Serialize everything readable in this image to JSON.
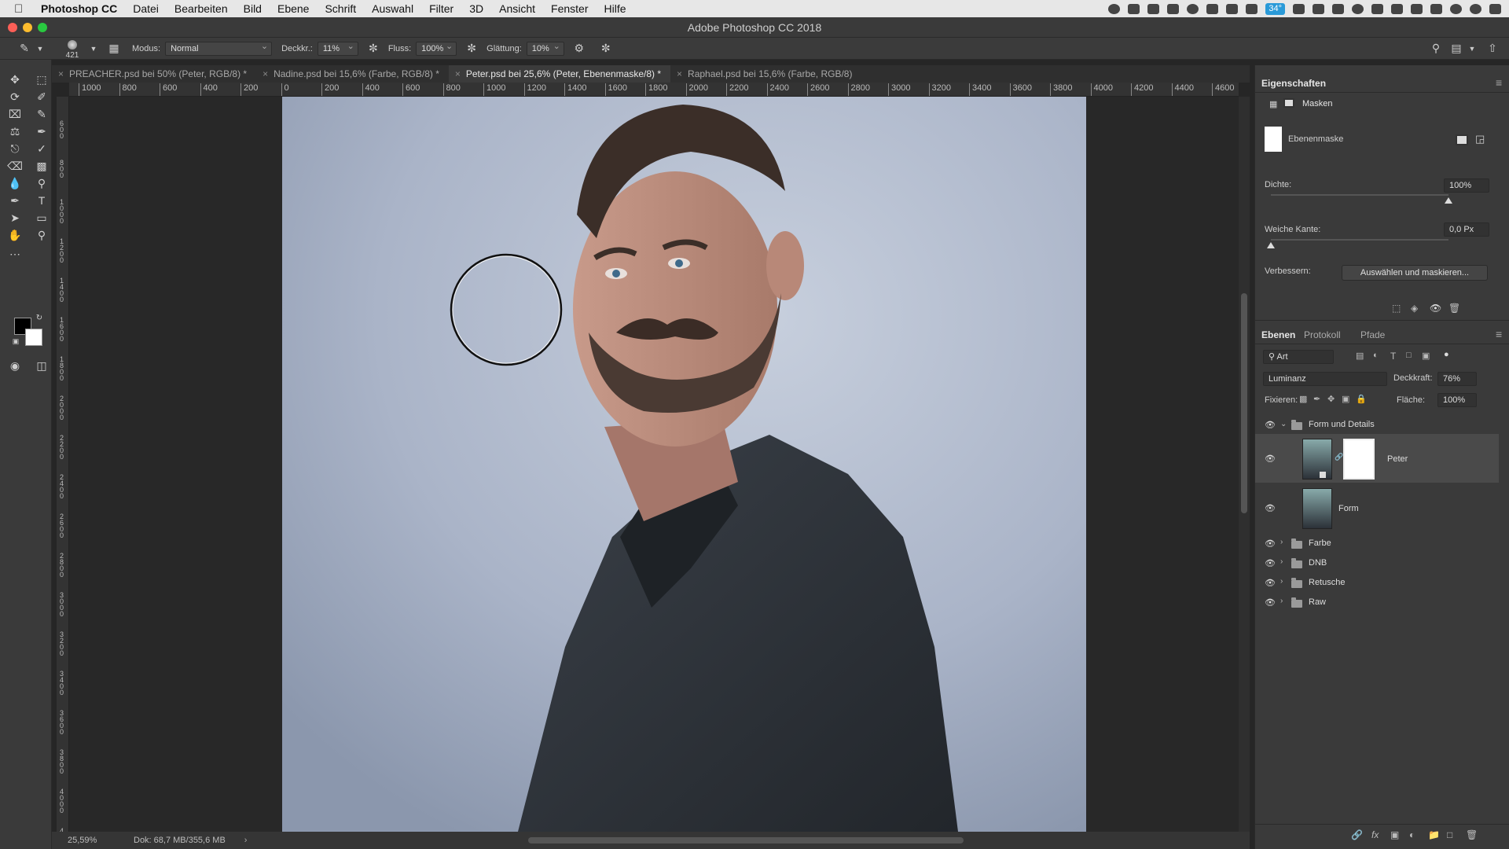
{
  "menubar": {
    "app_name": "Photoshop CC",
    "items": [
      "Datei",
      "Bearbeiten",
      "Bild",
      "Ebene",
      "Schrift",
      "Auswahl",
      "Filter",
      "3D",
      "Ansicht",
      "Fenster",
      "Hilfe"
    ],
    "battery": "34°"
  },
  "window": {
    "title": "Adobe Photoshop CC 2018"
  },
  "options": {
    "brush_size": "421",
    "mode_label": "Modus:",
    "mode_value": "Normal",
    "opacity_label": "Deckkr.:",
    "opacity_value": "11%",
    "flow_label": "Fluss:",
    "flow_value": "100%",
    "smoothing_label": "Glättung:",
    "smoothing_value": "10%"
  },
  "tabs": [
    {
      "label": "PREACHER.psd bei 50% (Peter, RGB/8) *"
    },
    {
      "label": "Nadine.psd bei 15,6% (Farbe, RGB/8) *"
    },
    {
      "label": "Peter.psd bei 25,6% (Peter, Ebenenmaske/8) *"
    },
    {
      "label": "Raphael.psd bei 15,6% (Farbe, RGB/8)"
    }
  ],
  "ruler": {
    "h_labels": [
      "1000",
      "800",
      "600",
      "400",
      "200",
      "0",
      "200",
      "400",
      "600",
      "800",
      "1000",
      "1200",
      "1400",
      "1600",
      "1800",
      "2000",
      "2200",
      "2400",
      "2600",
      "2800",
      "3000",
      "3200",
      "3400",
      "3600",
      "3800",
      "4000",
      "4200",
      "4400",
      "4600"
    ],
    "v_labels": [
      "6 0 0",
      "8 0 0",
      "1 0 0 0",
      "1 2 0 0",
      "1 4 0 0",
      "1 6 0 0",
      "1 8 0 0",
      "2 0 0 0",
      "2 2 0 0",
      "2 4 0 0",
      "2 6 0 0",
      "2 8 0 0",
      "3 0 0 0",
      "3 2 0 0",
      "3 4 0 0",
      "3 6 0 0",
      "3 8 0 0",
      "4 0 0 0",
      "4 2 0 0"
    ]
  },
  "status": {
    "zoom": "25,59%",
    "doc": "Dok: 68,7 MB/355,6 MB"
  },
  "properties": {
    "title": "Eigenschaften",
    "section": "Masken",
    "mask_name": "Ebenenmaske",
    "density_label": "Dichte:",
    "density_value": "100%",
    "density_level": 1.0,
    "feather_label": "Weiche Kante:",
    "feather_value": "0,0 Px",
    "feather_level": 0.0,
    "refine_label": "Verbessern:",
    "refine_button": "Auswählen und maskieren..."
  },
  "layers_panel": {
    "tabs": [
      "Ebenen",
      "Protokoll",
      "Pfade"
    ],
    "filter": "Art",
    "blend_mode": "Luminanz",
    "opacity_label": "Deckkraft:",
    "opacity_value": "76%",
    "lock_label": "Fixieren:",
    "fill_label": "Fläche:",
    "fill_value": "100%",
    "layers": [
      {
        "name": "Form und Details",
        "type": "group",
        "expanded": true
      },
      {
        "name": "Peter",
        "type": "layer",
        "selected": true
      },
      {
        "name": "Form",
        "type": "layer"
      },
      {
        "name": "Farbe",
        "type": "group"
      },
      {
        "name": "DNB",
        "type": "group"
      },
      {
        "name": "Retusche",
        "type": "group"
      },
      {
        "name": "Raw",
        "type": "group"
      }
    ]
  },
  "colors": {
    "accent": "#2a9ad8",
    "panel": "#3a3a3a",
    "canvas": "#282828"
  }
}
